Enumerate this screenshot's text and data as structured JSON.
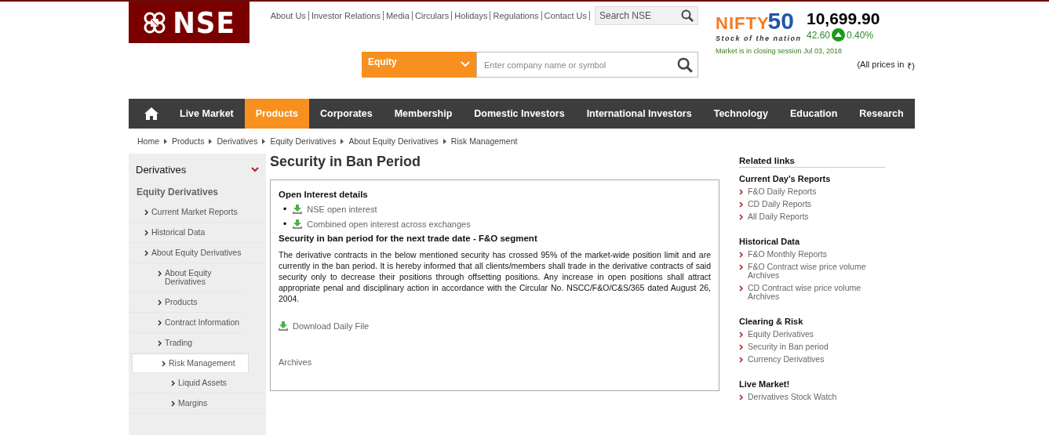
{
  "logo": {
    "text": "NSE"
  },
  "top_links": [
    "About Us",
    "Investor Relations",
    "Media",
    "Circulars",
    "Holidays",
    "Regulations",
    "Contact Us"
  ],
  "site_search": {
    "placeholder": "Search NSE"
  },
  "index": {
    "name": "NIFTY",
    "number": "50",
    "tagline": "Stock of the nation",
    "value": "10,699.90",
    "change": "42.60",
    "change_pct": "0.40%"
  },
  "market_status": "Market is in closing session Jul 03, 2018",
  "prices_note": "(All prices in",
  "currency": "₹)",
  "quote_search": {
    "segment": "Equity",
    "placeholder": "Enter company name or symbol"
  },
  "nav": [
    {
      "label": "Live Market",
      "selected": false
    },
    {
      "label": "Products",
      "selected": true
    },
    {
      "label": "Corporates",
      "selected": false
    },
    {
      "label": "Membership",
      "selected": false
    },
    {
      "label": "Domestic Investors",
      "selected": false
    },
    {
      "label": "International Investors",
      "selected": false
    },
    {
      "label": "Technology",
      "selected": false
    },
    {
      "label": "Education",
      "selected": false
    },
    {
      "label": "Research",
      "selected": false
    }
  ],
  "breadcrumb": [
    "Home",
    "Products",
    "Derivatives",
    "Equity Derivatives",
    "About Equity Derivatives",
    "Risk Management"
  ],
  "sidebar": {
    "title": "Derivatives",
    "expanded": true,
    "section": "Equity Derivatives",
    "items": [
      {
        "label": "Current Market Reports",
        "selected": false
      },
      {
        "label": "Historical Data",
        "selected": false
      },
      {
        "label": "About Equity Derivatives",
        "selected": false,
        "children": [
          {
            "label": "About Equity Derivatives",
            "selected": false
          },
          {
            "label": "Products",
            "selected": false
          },
          {
            "label": "Contract Information",
            "selected": false
          },
          {
            "label": "Trading",
            "selected": false
          },
          {
            "label": "Risk Management",
            "selected": true,
            "children": [
              {
                "label": "Liquid Assets",
                "selected": false
              },
              {
                "label": "Margins",
                "selected": false
              }
            ]
          }
        ]
      }
    ]
  },
  "page_title": "Security in Ban Period",
  "panel": {
    "oi_heading": "Open Interest details",
    "downloads": [
      {
        "bullet": "•",
        "label": "NSE open interest"
      },
      {
        "bullet": "•",
        "label": "Combined open interest across exchanges"
      }
    ],
    "ban_heading": "Security in ban period for the next trade date - F&O segment",
    "body": "The derivative contracts in the below mentioned security has crossed 95% of the market-wide position limit and are currently in the ban period. It is hereby informed that all clients/members shall trade in the derivative contracts of said security only to decrease their positions through offsetting positions. Any increase in open positions shall attract appropriate penal and disciplinary action in accordance with the Circular No. NSCC/F&O/C&S/365 dated August 26, 2004.",
    "daily_file": "Download Daily File",
    "archives": "Archives"
  },
  "related": {
    "title": "Related links",
    "groups": [
      {
        "heading": "Current Day's Reports",
        "links": [
          "F&O Daily Reports",
          "CD Daily Reports",
          "All Daily Reports"
        ]
      },
      {
        "heading": "Historical Data",
        "links": [
          "F&O Monthly Reports",
          "F&O Contract wise price volume Archives",
          "CD Contract wise price volume Archives"
        ]
      },
      {
        "heading": "Clearing & Risk",
        "links": [
          "Equity Derivatives",
          "Security in Ban period",
          "Currency Derivatives"
        ]
      },
      {
        "heading": "Live Market!",
        "links": [
          "Derivatives Stock Watch"
        ]
      }
    ]
  }
}
